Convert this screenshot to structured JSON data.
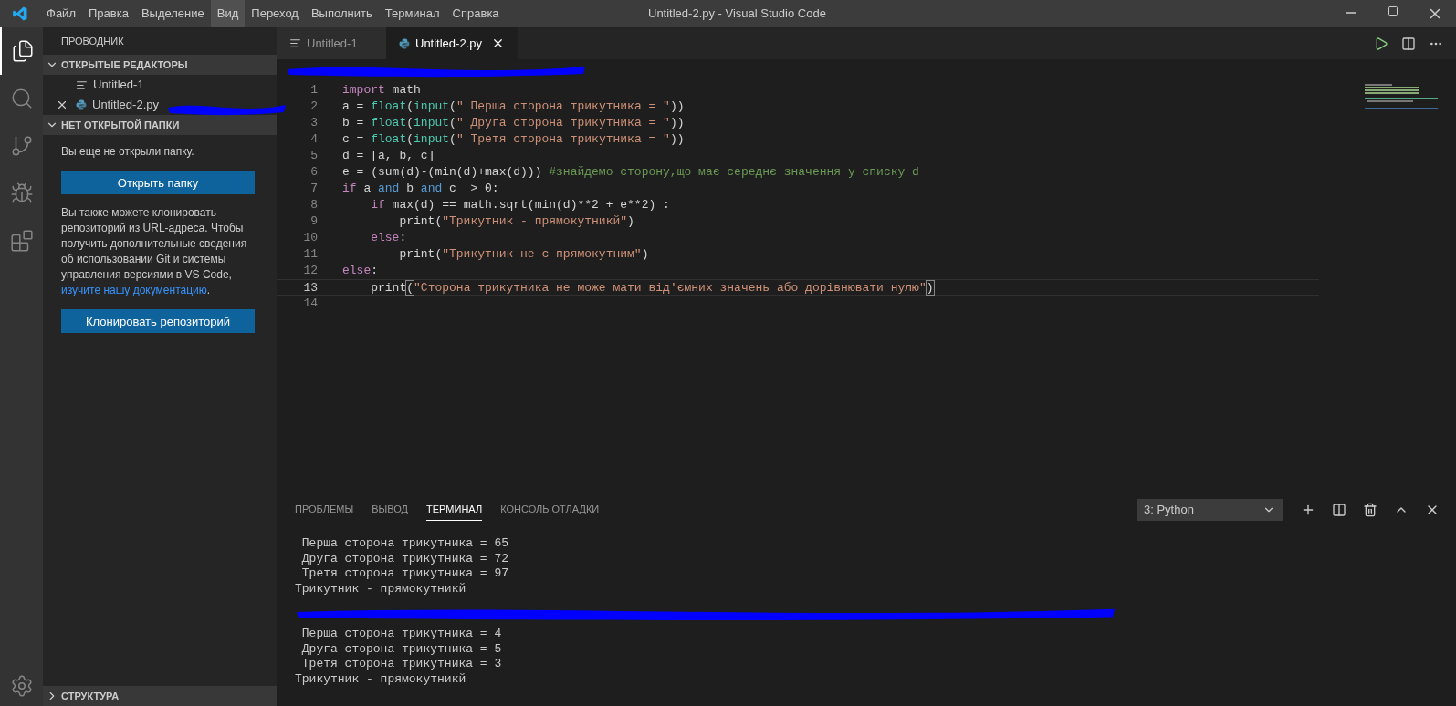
{
  "menu": [
    {
      "label": "Файл",
      "highlighted": false
    },
    {
      "label": "Правка",
      "highlighted": false
    },
    {
      "label": "Выделение",
      "highlighted": false
    },
    {
      "label": "Вид",
      "highlighted": true
    },
    {
      "label": "Переход",
      "highlighted": false
    },
    {
      "label": "Выполнить",
      "highlighted": false
    },
    {
      "label": "Терминал",
      "highlighted": false
    },
    {
      "label": "Справка",
      "highlighted": false
    }
  ],
  "window": {
    "title": "Untitled-2.py - Visual Studio Code"
  },
  "activity_bar": [
    {
      "kind": "files",
      "selected": true
    },
    {
      "kind": "search",
      "selected": false
    },
    {
      "kind": "git",
      "selected": false
    },
    {
      "kind": "debug",
      "selected": false
    },
    {
      "kind": "extensions",
      "selected": false
    }
  ],
  "sidebar": {
    "title": "ПРОВОДНИК",
    "open_editors": {
      "title": "ОТКРЫТЫЕ РЕДАКТОРЫ",
      "expanded": true,
      "items": [
        {
          "name": "Untitled-1",
          "kind": "text",
          "close": false
        },
        {
          "name": "Untitled-2.py",
          "kind": "python",
          "close": true
        }
      ]
    },
    "no_folder": {
      "title": "НЕТ ОТКРЫТОЙ ПАПКИ",
      "expanded": true,
      "message": "Вы еще не открыли папку.",
      "open_button": "Открыть папку",
      "paragraph": "Вы также можете клонировать репозиторий из URL-адреса. Чтобы получить дополнительные сведения об использовании Git и системы управления версиями в VS Code,",
      "link": "изучите нашу документацию",
      "after_link": ".",
      "clone_button": "Клонировать репозиторий"
    },
    "outline": {
      "title": "СТРУКТУРА",
      "expanded": false
    }
  },
  "tabs": [
    {
      "label": "Untitled-1",
      "kind": "text",
      "selected": false
    },
    {
      "label": "Untitled-2.py",
      "kind": "python",
      "selected": true
    }
  ],
  "editor": {
    "lines": [
      {
        "number": "1",
        "current": false,
        "tokens": [
          {
            "text": "import",
            "kind": "control"
          },
          {
            "text": " math",
            "kind": "plain"
          }
        ]
      },
      {
        "number": "2",
        "current": false,
        "tokens": [
          {
            "text": "a = ",
            "kind": "plain"
          },
          {
            "text": "float",
            "kind": "type"
          },
          {
            "text": "(",
            "kind": "plain"
          },
          {
            "text": "input",
            "kind": "type"
          },
          {
            "text": "(",
            "kind": "plain"
          },
          {
            "text": "\" Перша сторона трикутника = \"",
            "kind": "string"
          },
          {
            "text": "))",
            "kind": "plain"
          }
        ]
      },
      {
        "number": "3",
        "current": false,
        "tokens": [
          {
            "text": "b = ",
            "kind": "plain"
          },
          {
            "text": "float",
            "kind": "type"
          },
          {
            "text": "(",
            "kind": "plain"
          },
          {
            "text": "input",
            "kind": "type"
          },
          {
            "text": "(",
            "kind": "plain"
          },
          {
            "text": "\" Друга сторона трикутника = \"",
            "kind": "string"
          },
          {
            "text": "))",
            "kind": "plain"
          }
        ]
      },
      {
        "number": "4",
        "current": false,
        "tokens": [
          {
            "text": "c = ",
            "kind": "plain"
          },
          {
            "text": "float",
            "kind": "type"
          },
          {
            "text": "(",
            "kind": "plain"
          },
          {
            "text": "input",
            "kind": "type"
          },
          {
            "text": "(",
            "kind": "plain"
          },
          {
            "text": "\" Третя сторона трикутника = \"",
            "kind": "string"
          },
          {
            "text": "))",
            "kind": "plain"
          }
        ]
      },
      {
        "number": "5",
        "current": false,
        "tokens": [
          {
            "text": "d = [a, b, c]",
            "kind": "plain"
          }
        ]
      },
      {
        "number": "6",
        "current": false,
        "tokens": [
          {
            "text": "e = (sum(d)-(min(d)+max(d))) ",
            "kind": "plain"
          },
          {
            "text": "#знайдемо сторону,що має середнє значення у списку d",
            "kind": "comment"
          }
        ]
      },
      {
        "number": "7",
        "current": false,
        "tokens": [
          {
            "text": "if",
            "kind": "control"
          },
          {
            "text": " a ",
            "kind": "plain"
          },
          {
            "text": "and",
            "kind": "keyword"
          },
          {
            "text": " b ",
            "kind": "plain"
          },
          {
            "text": "and",
            "kind": "keyword"
          },
          {
            "text": " c  > 0:",
            "kind": "plain"
          }
        ]
      },
      {
        "number": "8",
        "current": false,
        "tokens": [
          {
            "text": "    if",
            "kind": "control"
          },
          {
            "text": " max(d) == math.sqrt(min(d)**2 + e**2) :",
            "kind": "plain"
          }
        ]
      },
      {
        "number": "9",
        "current": false,
        "tokens": [
          {
            "text": "        print(",
            "kind": "plain"
          },
          {
            "text": "\"Трикутник - прямокутникй\"",
            "kind": "string"
          },
          {
            "text": ")",
            "kind": "plain"
          }
        ]
      },
      {
        "number": "10",
        "current": false,
        "tokens": [
          {
            "text": "    else",
            "kind": "control"
          },
          {
            "text": ":",
            "kind": "plain"
          }
        ]
      },
      {
        "number": "11",
        "current": false,
        "tokens": [
          {
            "text": "        print(",
            "kind": "plain"
          },
          {
            "text": "\"Трикутник не є прямокутним\"",
            "kind": "string"
          },
          {
            "text": ")",
            "kind": "plain"
          }
        ]
      },
      {
        "number": "12",
        "current": false,
        "tokens": [
          {
            "text": "else",
            "kind": "control"
          },
          {
            "text": ":",
            "kind": "plain"
          }
        ]
      },
      {
        "number": "13",
        "current": true,
        "tokens": [
          {
            "text": "    print",
            "kind": "plain"
          },
          {
            "text": "(",
            "kind": "bracket"
          },
          {
            "text": "\"Сторона трикутника не може мати від'ємних значень або дорівнювати нулю\"",
            "kind": "string"
          },
          {
            "text": ")",
            "kind": "bracket"
          }
        ]
      },
      {
        "number": "14",
        "current": false
      }
    ]
  },
  "panel": {
    "tabs": [
      {
        "label": "ПРОБЛЕМЫ",
        "selected": false
      },
      {
        "label": "ВЫВОД",
        "selected": false
      },
      {
        "label": "ТЕРМИНАЛ",
        "selected": true
      },
      {
        "label": "КОНСОЛЬ ОТЛАДКИ",
        "selected": false
      }
    ],
    "terminal_select": "3: Python",
    "terminal_lines": [
      {
        "text": " Перша сторона трикутника = 65",
        "kind": "text"
      },
      {
        "text": " Друга сторона трикутника = 72",
        "kind": "text"
      },
      {
        "text": " Третя сторона трикутника = 97",
        "kind": "text"
      },
      {
        "text": "Трикутник - прямокутникй",
        "kind": "text"
      },
      {
        "kind": "redacted"
      },
      {
        "text": " Перша сторона трикутника = 4",
        "kind": "text"
      },
      {
        "text": " Друга сторона трикутника = 5",
        "kind": "text"
      },
      {
        "text": " Третя сторона трикутника = 3",
        "kind": "text"
      },
      {
        "text": "Трикутник - прямокутникй",
        "kind": "text"
      }
    ]
  }
}
